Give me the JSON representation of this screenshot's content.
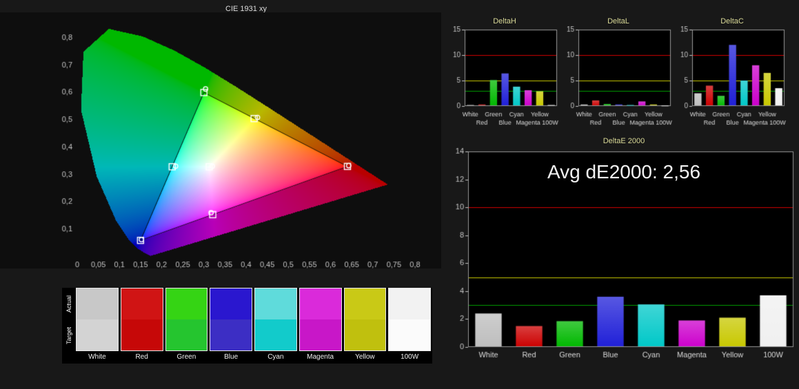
{
  "theme": {
    "page_bg": "#181818",
    "plot_bg": "#000000",
    "cie_bg": "#0e0e0e",
    "axis_text": "#c4c4c4",
    "chart_title_color": "#d8d896",
    "cie_title_color": "#dcdcdc",
    "plot_border": "#9a9a9a",
    "annotation_color": "#f2f2f2",
    "ref_red": "#d40000",
    "ref_yellow": "#c8c800",
    "ref_green": "#00a000"
  },
  "chart_data": [
    {
      "id": "cie",
      "type": "scatter",
      "title": "CIE 1931 xy",
      "x_ticks": [
        "0",
        "0,05",
        "0,1",
        "0,15",
        "0,2",
        "0,25",
        "0,3",
        "0,35",
        "0,4",
        "0,45",
        "0,5",
        "0,55",
        "0,6",
        "0,65",
        "0,7",
        "0,75",
        "0,8"
      ],
      "y_ticks": [
        "0,1",
        "0,2",
        "0,3",
        "0,4",
        "0,5",
        "0,6",
        "0,7",
        "0,8"
      ],
      "x_range": [
        0,
        0.8
      ],
      "y_range": [
        0,
        0.86
      ],
      "gamut_triangle": [
        [
          0.64,
          0.33
        ],
        [
          0.3,
          0.6
        ],
        [
          0.15,
          0.06
        ]
      ],
      "points": [
        {
          "name": "White",
          "target": [
            0.3127,
            0.329
          ],
          "measured": [
            0.32,
            0.331
          ]
        },
        {
          "name": "Red",
          "target": [
            0.64,
            0.33
          ],
          "measured": [
            0.643,
            0.333
          ]
        },
        {
          "name": "Green",
          "target": [
            0.3,
            0.6
          ],
          "measured": [
            0.304,
            0.613
          ]
        },
        {
          "name": "Blue",
          "target": [
            0.15,
            0.06
          ],
          "measured": [
            0.152,
            0.063
          ]
        },
        {
          "name": "Cyan",
          "target": [
            0.225,
            0.329
          ],
          "measured": [
            0.233,
            0.331
          ]
        },
        {
          "name": "Magenta",
          "target": [
            0.321,
            0.154
          ],
          "measured": [
            0.317,
            0.161
          ]
        },
        {
          "name": "Yellow",
          "target": [
            0.419,
            0.505
          ],
          "measured": [
            0.427,
            0.509
          ]
        }
      ],
      "spectral_locus": [
        [
          0.1741,
          0.005
        ],
        [
          0.174,
          0.0049
        ],
        [
          0.1733,
          0.0048
        ],
        [
          0.1726,
          0.0048
        ],
        [
          0.1714,
          0.0051
        ],
        [
          0.1689,
          0.0069
        ],
        [
          0.1644,
          0.0109
        ],
        [
          0.1566,
          0.0177
        ],
        [
          0.144,
          0.0297
        ],
        [
          0.1241,
          0.0578
        ],
        [
          0.0913,
          0.1327
        ],
        [
          0.0454,
          0.295
        ],
        [
          0.0082,
          0.5384
        ],
        [
          0.0139,
          0.7502
        ],
        [
          0.0743,
          0.8338
        ],
        [
          0.1547,
          0.8059
        ],
        [
          0.2296,
          0.7543
        ],
        [
          0.3016,
          0.6923
        ],
        [
          0.3731,
          0.6245
        ],
        [
          0.4441,
          0.5547
        ],
        [
          0.5125,
          0.4866
        ],
        [
          0.5752,
          0.4242
        ],
        [
          0.627,
          0.3725
        ],
        [
          0.6658,
          0.334
        ],
        [
          0.6915,
          0.3083
        ],
        [
          0.7079,
          0.292
        ],
        [
          0.719,
          0.2809
        ],
        [
          0.726,
          0.274
        ],
        [
          0.73,
          0.27
        ],
        [
          0.732,
          0.268
        ],
        [
          0.7334,
          0.2666
        ],
        [
          0.7347,
          0.2653
        ]
      ]
    },
    {
      "id": "deltaH",
      "type": "bar",
      "title": "DeltaH",
      "ylim": [
        0,
        15
      ],
      "yticks": [
        0,
        5,
        10,
        15
      ],
      "categories": [
        "White",
        "Red",
        "Green",
        "Blue",
        "Cyan",
        "Magenta",
        "Yellow",
        "100W"
      ],
      "values": [
        0.2,
        0.3,
        5.1,
        6.4,
        3.8,
        3.1,
        2.9,
        0.2
      ],
      "colors": [
        "#bebebe",
        "#cc0000",
        "#00b800",
        "#2020d8",
        "#00c8c8",
        "#cc00cc",
        "#c8c800",
        "#f0f0f0"
      ],
      "ref_lines": [
        {
          "y": 10,
          "color": "#d40000"
        },
        {
          "y": 5,
          "color": "#c8c800"
        },
        {
          "y": 3,
          "color": "#00a000"
        }
      ]
    },
    {
      "id": "deltaL",
      "type": "bar",
      "title": "DeltaL",
      "ylim": [
        0,
        15
      ],
      "yticks": [
        0,
        5,
        10,
        15
      ],
      "categories": [
        "White",
        "Red",
        "Green",
        "Blue",
        "Cyan",
        "Magenta",
        "Yellow",
        "100W"
      ],
      "values": [
        0.3,
        1.1,
        0.4,
        0.3,
        0.2,
        0.9,
        0.3,
        0.1
      ],
      "colors": [
        "#bebebe",
        "#cc0000",
        "#00b800",
        "#2020d8",
        "#00c8c8",
        "#cc00cc",
        "#c8c800",
        "#f0f0f0"
      ],
      "ref_lines": [
        {
          "y": 10,
          "color": "#d40000"
        },
        {
          "y": 5,
          "color": "#c8c800"
        },
        {
          "y": 3,
          "color": "#00a000"
        }
      ]
    },
    {
      "id": "deltaC",
      "type": "bar",
      "title": "DeltaC",
      "ylim": [
        0,
        15
      ],
      "yticks": [
        0,
        5,
        10,
        15
      ],
      "categories": [
        "White",
        "Red",
        "Green",
        "Blue",
        "Cyan",
        "Magenta",
        "Yellow",
        "100W"
      ],
      "values": [
        2.5,
        4,
        2,
        12,
        5,
        8,
        6.5,
        3.5
      ],
      "colors": [
        "#bebebe",
        "#cc0000",
        "#00b800",
        "#2020d8",
        "#00c8c8",
        "#cc00cc",
        "#c8c800",
        "#f0f0f0"
      ],
      "ref_lines": [
        {
          "y": 10,
          "color": "#d40000"
        },
        {
          "y": 5,
          "color": "#c8c800"
        },
        {
          "y": 3,
          "color": "#00a000"
        }
      ]
    },
    {
      "id": "deltaE",
      "type": "bar",
      "title": "DeltaE 2000",
      "annotation": "Avg dE2000: 2,56",
      "ylim": [
        0,
        14
      ],
      "yticks": [
        0,
        2,
        4,
        6,
        8,
        10,
        12,
        14
      ],
      "categories": [
        "White",
        "Red",
        "Green",
        "Blue",
        "Cyan",
        "Magenta",
        "Yellow",
        "100W"
      ],
      "values": [
        2.4,
        1.5,
        1.85,
        3.6,
        3.05,
        1.9,
        2.1,
        3.7
      ],
      "colors": [
        "#bebebe",
        "#cc0000",
        "#00b800",
        "#2020d8",
        "#00c8c8",
        "#cc00cc",
        "#c8c800",
        "#f0f0f0"
      ],
      "ref_lines": [
        {
          "y": 10,
          "color": "#d40000"
        },
        {
          "y": 5,
          "color": "#c8c800"
        },
        {
          "y": 3,
          "color": "#00a000"
        }
      ]
    }
  ],
  "swatches": {
    "row_labels": [
      "Actual",
      "Target"
    ],
    "column_labels": [
      "White",
      "Red",
      "Green",
      "Blue",
      "Cyan",
      "Magenta",
      "Yellow",
      "100W"
    ],
    "columns": [
      {
        "name": "White",
        "actual": "#c8c8c8",
        "target": "#d3d3d3"
      },
      {
        "name": "Red",
        "actual": "#d01414",
        "target": "#c60808"
      },
      {
        "name": "Green",
        "actual": "#35d414",
        "target": "#25c52f"
      },
      {
        "name": "Blue",
        "actual": "#2a17cf",
        "target": "#3c2ec4"
      },
      {
        "name": "Cyan",
        "actual": "#5fdbdb",
        "target": "#12cbcb"
      },
      {
        "name": "Magenta",
        "actual": "#da2ada",
        "target": "#c817c8"
      },
      {
        "name": "Yellow",
        "actual": "#c9c916",
        "target": "#c0c00e"
      },
      {
        "name": "100W",
        "actual": "#f2f2f2",
        "target": "#fbfbfb"
      }
    ]
  }
}
